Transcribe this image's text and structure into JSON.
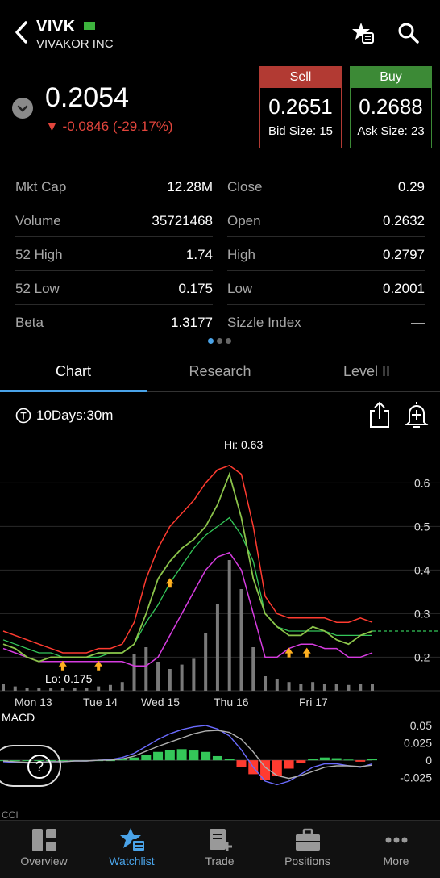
{
  "header": {
    "symbol": "VIVK",
    "company": "VIVAKOR INC",
    "flag_color": "#3db33d"
  },
  "quote": {
    "last": "0.2054",
    "change": "▼ -0.0846 (-29.17%)",
    "sell": {
      "label": "Sell",
      "price": "0.2651",
      "size": "Bid Size: 15"
    },
    "buy": {
      "label": "Buy",
      "price": "0.2688",
      "size": "Ask Size: 23"
    }
  },
  "stats": [
    {
      "l_label": "Mkt Cap",
      "l_value": "12.28M",
      "r_label": "Close",
      "r_value": "0.29"
    },
    {
      "l_label": "Volume",
      "l_value": "35721468",
      "r_label": "Open",
      "r_value": "0.2632"
    },
    {
      "l_label": "52 High",
      "l_value": "1.74",
      "r_label": "High",
      "r_value": "0.2797"
    },
    {
      "l_label": "52 Low",
      "l_value": "0.175",
      "r_label": "Low",
      "r_value": "0.2001"
    },
    {
      "l_label": "Beta",
      "l_value": "1.3177",
      "r_label": "Sizzle Index",
      "r_value": "—"
    }
  ],
  "tabs": [
    {
      "label": "Chart",
      "active": true
    },
    {
      "label": "Research",
      "active": false
    },
    {
      "label": "Level II",
      "active": false
    }
  ],
  "chart_controls": {
    "range": "10Days:30m"
  },
  "chart_data": {
    "type": "line",
    "hi_label": "Hi: 0.63",
    "lo_label": "Lo: 0.175",
    "x_labels": [
      "Mon 13",
      "Tue 14",
      "Wed 15",
      "Thu 16",
      "Fri 17"
    ],
    "y_ticks": [
      "0.6",
      "0.5",
      "0.4",
      "0.3",
      "0.2"
    ],
    "ylim": [
      0.16,
      0.66
    ],
    "price": [
      0.23,
      0.22,
      0.2,
      0.19,
      0.2,
      0.2,
      0.2,
      0.2,
      0.21,
      0.21,
      0.21,
      0.23,
      0.3,
      0.38,
      0.42,
      0.45,
      0.47,
      0.5,
      0.55,
      0.62,
      0.52,
      0.38,
      0.3,
      0.27,
      0.25,
      0.25,
      0.27,
      0.26,
      0.24,
      0.23,
      0.25,
      0.26
    ],
    "upper_band": [
      0.26,
      0.25,
      0.24,
      0.23,
      0.22,
      0.21,
      0.21,
      0.21,
      0.22,
      0.22,
      0.23,
      0.28,
      0.38,
      0.45,
      0.5,
      0.53,
      0.56,
      0.6,
      0.63,
      0.64,
      0.62,
      0.5,
      0.34,
      0.3,
      0.29,
      0.29,
      0.29,
      0.29,
      0.28,
      0.28,
      0.29,
      0.28
    ],
    "lower_band": [
      0.22,
      0.21,
      0.2,
      0.19,
      0.19,
      0.19,
      0.19,
      0.19,
      0.19,
      0.19,
      0.19,
      0.18,
      0.18,
      0.2,
      0.25,
      0.3,
      0.35,
      0.4,
      0.43,
      0.44,
      0.4,
      0.3,
      0.2,
      0.2,
      0.22,
      0.23,
      0.23,
      0.22,
      0.22,
      0.2,
      0.2,
      0.21
    ],
    "mid_band": [
      0.24,
      0.23,
      0.22,
      0.21,
      0.21,
      0.2,
      0.2,
      0.2,
      0.2,
      0.21,
      0.21,
      0.23,
      0.28,
      0.32,
      0.37,
      0.41,
      0.45,
      0.48,
      0.5,
      0.52,
      0.48,
      0.42,
      0.3,
      0.27,
      0.26,
      0.26,
      0.26,
      0.26,
      0.25,
      0.25,
      0.25,
      0.25
    ],
    "volume": [
      0.05,
      0.03,
      0.02,
      0.02,
      0.02,
      0.02,
      0.02,
      0.02,
      0.03,
      0.04,
      0.06,
      0.25,
      0.3,
      0.2,
      0.15,
      0.18,
      0.22,
      0.4,
      0.6,
      0.9,
      0.7,
      0.3,
      0.1,
      0.08,
      0.06,
      0.05,
      0.06,
      0.05,
      0.05,
      0.04,
      0.05,
      0.05
    ],
    "macd": {
      "label": "MACD",
      "y_ticks": [
        "0.05",
        "0.025",
        "0",
        "-0.025"
      ],
      "ylim": [
        -0.045,
        0.065
      ],
      "hist": [
        0,
        0,
        0,
        0,
        0,
        0,
        0,
        0,
        0,
        0,
        0.002,
        0.004,
        0.008,
        0.012,
        0.015,
        0.016,
        0.014,
        0.012,
        0.006,
        0.002,
        -0.01,
        -0.02,
        -0.028,
        -0.022,
        -0.012,
        -0.004,
        0.002,
        0.004,
        0.003,
        0.001,
        -0.002,
        0.002
      ],
      "line1": [
        -0.002,
        -0.003,
        -0.004,
        -0.003,
        -0.002,
        -0.002,
        -0.001,
        -0.001,
        0,
        0.001,
        0.004,
        0.01,
        0.02,
        0.03,
        0.038,
        0.044,
        0.048,
        0.05,
        0.045,
        0.035,
        0.015,
        -0.01,
        -0.03,
        -0.035,
        -0.03,
        -0.02,
        -0.01,
        -0.005,
        -0.005,
        -0.008,
        -0.01,
        -0.005
      ],
      "line2": [
        -0.001,
        -0.002,
        -0.003,
        -0.003,
        -0.002,
        -0.002,
        -0.001,
        -0.001,
        0,
        0,
        0.002,
        0.006,
        0.013,
        0.02,
        0.026,
        0.032,
        0.038,
        0.042,
        0.043,
        0.04,
        0.03,
        0.012,
        -0.01,
        -0.022,
        -0.026,
        -0.022,
        -0.016,
        -0.01,
        -0.008,
        -0.008,
        -0.009,
        -0.007
      ]
    },
    "colors": {
      "price": "#8bc34a",
      "upper": "#ff3b30",
      "lower": "#d63ce0",
      "mid": "#34c759",
      "volume": "#7a7a7a",
      "macd_pos": "#34c759",
      "macd_neg": "#ff3b30",
      "macd_line1": "#6b6bff",
      "macd_line2": "#b0b0b0",
      "signal_arrow": "#ffb020"
    }
  },
  "help": {
    "label": "?"
  },
  "tabbar": [
    {
      "label": "Overview",
      "icon": "overview-icon",
      "active": false
    },
    {
      "label": "Watchlist",
      "icon": "watchlist-icon",
      "active": true
    },
    {
      "label": "Trade",
      "icon": "trade-icon",
      "active": false
    },
    {
      "label": "Positions",
      "icon": "positions-icon",
      "active": false
    },
    {
      "label": "More",
      "icon": "more-icon",
      "active": false
    }
  ]
}
